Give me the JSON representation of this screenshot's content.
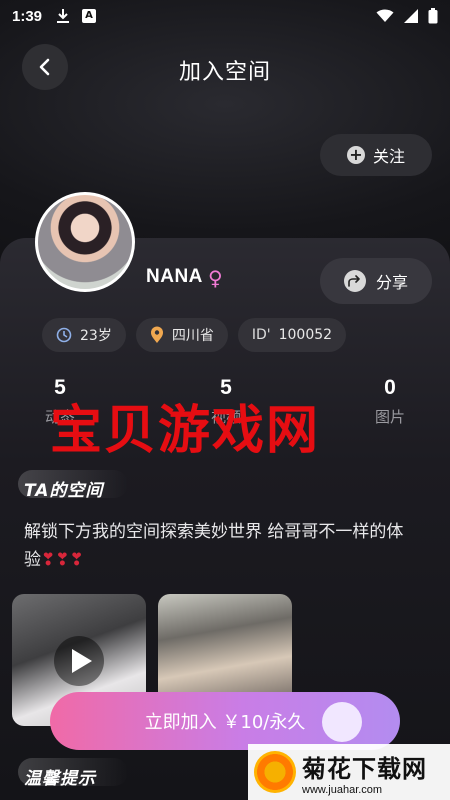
{
  "status_bar": {
    "time": "1:39",
    "a_badge": "A"
  },
  "header": {
    "title": "加入空间"
  },
  "actions": {
    "follow_label": "关注",
    "share_label": "分享"
  },
  "profile": {
    "name": "NANA",
    "gender_icon": "female-icon",
    "age": "23岁",
    "location": "四川省",
    "id_label": "ID'",
    "id_value": "100052"
  },
  "stats": [
    {
      "value": "5",
      "label": "动态"
    },
    {
      "value": "5",
      "label": "视频"
    },
    {
      "value": "0",
      "label": "图片"
    }
  ],
  "watermark_text": "宝贝游戏网",
  "section": {
    "space_title": "TA的空间",
    "description": "解锁下方我的空间探索美妙世界 给哥哥不一样的体验",
    "hearts": "❣❣❣",
    "notice_title": "温馨提示"
  },
  "join": {
    "label": "立即加入 ￥10/永久"
  },
  "site_badge": {
    "name": "菊花下载网",
    "url": "www.juahar.com"
  },
  "colors": {
    "accent_pink": "#f06aa7",
    "accent_purple": "#b38cf0",
    "gender_pink": "#f07bd4",
    "watermark_red": "#e60d12"
  }
}
